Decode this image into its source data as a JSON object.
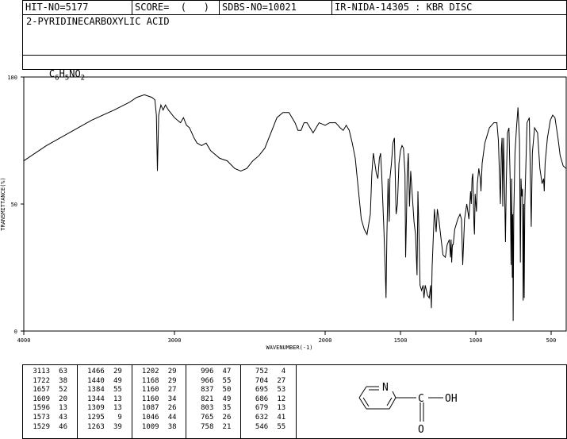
{
  "header": {
    "hit_no": "HIT-NO=5177",
    "score": "SCORE=  (   )",
    "sdbs_no": "SDBS-NO=10021",
    "ir_info": "IR-NIDA-14305 : KBR DISC"
  },
  "compound": {
    "name": "2-PYRIDINECARBOXYLIC ACID",
    "formula_parts": [
      "C",
      "6",
      "H",
      "5",
      "NO",
      "2"
    ]
  },
  "chart_data": {
    "type": "line",
    "xlabel": "WAVENUMBER(-1)",
    "ylabel": "TRANSMITTANCE(%)",
    "xlim": [
      4000,
      400
    ],
    "ylim": [
      0,
      100
    ],
    "x_reversed": true,
    "x_ticks": [
      4000,
      3000,
      2000,
      1500,
      1000,
      500
    ],
    "y_ticks": [
      0,
      50,
      100
    ],
    "x_tick_labels": [
      "4000",
      "3000",
      "2000",
      "1500",
      "1000",
      "500"
    ],
    "y_tick_labels": [
      "0",
      "50",
      "100"
    ],
    "series": [
      {
        "points": [
          [
            4000,
            67
          ],
          [
            3850,
            73
          ],
          [
            3700,
            78
          ],
          [
            3550,
            83
          ],
          [
            3400,
            87
          ],
          [
            3300,
            90
          ],
          [
            3250,
            92
          ],
          [
            3200,
            93
          ],
          [
            3150,
            92
          ],
          [
            3130,
            91
          ],
          [
            3120,
            85
          ],
          [
            3113,
            63
          ],
          [
            3105,
            85
          ],
          [
            3090,
            89
          ],
          [
            3075,
            87
          ],
          [
            3060,
            89
          ],
          [
            3040,
            87
          ],
          [
            3000,
            84
          ],
          [
            2960,
            82
          ],
          [
            2940,
            84
          ],
          [
            2920,
            81
          ],
          [
            2900,
            80
          ],
          [
            2870,
            76
          ],
          [
            2850,
            74
          ],
          [
            2820,
            73
          ],
          [
            2790,
            74
          ],
          [
            2760,
            71
          ],
          [
            2700,
            68
          ],
          [
            2650,
            67
          ],
          [
            2600,
            64
          ],
          [
            2560,
            63
          ],
          [
            2520,
            64
          ],
          [
            2480,
            67
          ],
          [
            2440,
            69
          ],
          [
            2400,
            72
          ],
          [
            2360,
            78
          ],
          [
            2320,
            84
          ],
          [
            2280,
            86
          ],
          [
            2240,
            86
          ],
          [
            2200,
            82
          ],
          [
            2180,
            79
          ],
          [
            2160,
            79
          ],
          [
            2140,
            82
          ],
          [
            2120,
            82
          ],
          [
            2100,
            80
          ],
          [
            2080,
            78
          ],
          [
            2060,
            80
          ],
          [
            2040,
            82
          ],
          [
            2000,
            81
          ],
          [
            1970,
            82
          ],
          [
            1930,
            82
          ],
          [
            1900,
            80
          ],
          [
            1880,
            79
          ],
          [
            1860,
            81
          ],
          [
            1840,
            79
          ],
          [
            1820,
            74
          ],
          [
            1800,
            68
          ],
          [
            1780,
            56
          ],
          [
            1760,
            44
          ],
          [
            1740,
            40
          ],
          [
            1722,
            38
          ],
          [
            1700,
            46
          ],
          [
            1690,
            62
          ],
          [
            1680,
            70
          ],
          [
            1670,
            66
          ],
          [
            1660,
            62
          ],
          [
            1650,
            60
          ],
          [
            1640,
            68
          ],
          [
            1632,
            70
          ],
          [
            1625,
            62
          ],
          [
            1610,
            40
          ],
          [
            1600,
            22
          ],
          [
            1596,
            13
          ],
          [
            1590,
            38
          ],
          [
            1582,
            60
          ],
          [
            1575,
            43
          ],
          [
            1570,
            60
          ],
          [
            1560,
            66
          ],
          [
            1550,
            74
          ],
          [
            1540,
            76
          ],
          [
            1529,
            46
          ],
          [
            1520,
            50
          ],
          [
            1510,
            66
          ],
          [
            1500,
            71
          ],
          [
            1490,
            73
          ],
          [
            1480,
            72
          ],
          [
            1470,
            62
          ],
          [
            1466,
            29
          ],
          [
            1460,
            45
          ],
          [
            1455,
            62
          ],
          [
            1448,
            70
          ],
          [
            1440,
            49
          ],
          [
            1432,
            63
          ],
          [
            1420,
            52
          ],
          [
            1410,
            43
          ],
          [
            1400,
            38
          ],
          [
            1390,
            22
          ],
          [
            1384,
            55
          ],
          [
            1378,
            40
          ],
          [
            1370,
            18
          ],
          [
            1360,
            16
          ],
          [
            1350,
            18
          ],
          [
            1344,
            13
          ],
          [
            1336,
            18
          ],
          [
            1320,
            14
          ],
          [
            1309,
            13
          ],
          [
            1300,
            18
          ],
          [
            1295,
            9
          ],
          [
            1290,
            25
          ],
          [
            1275,
            48
          ],
          [
            1263,
            39
          ],
          [
            1255,
            48
          ],
          [
            1245,
            44
          ],
          [
            1230,
            36
          ],
          [
            1218,
            30
          ],
          [
            1202,
            29
          ],
          [
            1190,
            34
          ],
          [
            1176,
            36
          ],
          [
            1168,
            29
          ],
          [
            1164,
            36
          ],
          [
            1160,
            27
          ],
          [
            1155,
            34
          ],
          [
            1150,
            34
          ],
          [
            1140,
            40
          ],
          [
            1120,
            44
          ],
          [
            1105,
            46
          ],
          [
            1095,
            44
          ],
          [
            1087,
            26
          ],
          [
            1075,
            44
          ],
          [
            1060,
            50
          ],
          [
            1050,
            46
          ],
          [
            1046,
            44
          ],
          [
            1035,
            55
          ],
          [
            1030,
            50
          ],
          [
            1025,
            60
          ],
          [
            1020,
            62
          ],
          [
            1012,
            42
          ],
          [
            1009,
            38
          ],
          [
            1004,
            54
          ],
          [
            996,
            47
          ],
          [
            990,
            58
          ],
          [
            980,
            64
          ],
          [
            970,
            60
          ],
          [
            966,
            55
          ],
          [
            958,
            66
          ],
          [
            940,
            74
          ],
          [
            910,
            80
          ],
          [
            880,
            82
          ],
          [
            860,
            82
          ],
          [
            850,
            75
          ],
          [
            837,
            50
          ],
          [
            830,
            72
          ],
          [
            826,
            76
          ],
          [
            821,
            49
          ],
          [
            816,
            76
          ],
          [
            810,
            60
          ],
          [
            803,
            35
          ],
          [
            798,
            58
          ],
          [
            790,
            78
          ],
          [
            780,
            80
          ],
          [
            772,
            60
          ],
          [
            766,
            26
          ],
          [
            762,
            60
          ],
          [
            758,
            21
          ],
          [
            755,
            46
          ],
          [
            752,
            4
          ],
          [
            748,
            46
          ],
          [
            740,
            70
          ],
          [
            730,
            80
          ],
          [
            720,
            88
          ],
          [
            710,
            75
          ],
          [
            704,
            27
          ],
          [
            700,
            60
          ],
          [
            695,
            53
          ],
          [
            690,
            56
          ],
          [
            686,
            12
          ],
          [
            682,
            50
          ],
          [
            679,
            13
          ],
          [
            675,
            50
          ],
          [
            660,
            82
          ],
          [
            645,
            84
          ],
          [
            632,
            41
          ],
          [
            625,
            70
          ],
          [
            610,
            80
          ],
          [
            590,
            78
          ],
          [
            575,
            64
          ],
          [
            560,
            58
          ],
          [
            550,
            60
          ],
          [
            546,
            55
          ],
          [
            540,
            66
          ],
          [
            525,
            76
          ],
          [
            505,
            83
          ],
          [
            490,
            85
          ],
          [
            475,
            84
          ],
          [
            455,
            76
          ],
          [
            440,
            69
          ],
          [
            420,
            65
          ],
          [
            400,
            64
          ]
        ]
      }
    ]
  },
  "peak_table": {
    "columns": [
      [
        [
          "3113",
          "63"
        ],
        [
          "1722",
          "38"
        ],
        [
          "1657",
          "52"
        ],
        [
          "1609",
          "20"
        ],
        [
          "1596",
          "13"
        ],
        [
          "1573",
          "43"
        ],
        [
          "1529",
          "46"
        ]
      ],
      [
        [
          "1466",
          "29"
        ],
        [
          "1440",
          "49"
        ],
        [
          "1384",
          "55"
        ],
        [
          "1344",
          "13"
        ],
        [
          "1309",
          "13"
        ],
        [
          "1295",
          "9"
        ],
        [
          "1263",
          "39"
        ]
      ],
      [
        [
          "1202",
          "29"
        ],
        [
          "1168",
          "29"
        ],
        [
          "1160",
          "27"
        ],
        [
          "1160",
          "34"
        ],
        [
          "1087",
          "26"
        ],
        [
          "1046",
          "44"
        ],
        [
          "1009",
          "38"
        ]
      ],
      [
        [
          "996",
          "47"
        ],
        [
          "966",
          "55"
        ],
        [
          "837",
          "50"
        ],
        [
          "821",
          "49"
        ],
        [
          "803",
          "35"
        ],
        [
          "765",
          "26"
        ],
        [
          "758",
          "21"
        ]
      ],
      [
        [
          "752",
          "4"
        ],
        [
          "704",
          "27"
        ],
        [
          "695",
          "53"
        ],
        [
          "686",
          "12"
        ],
        [
          "679",
          "13"
        ],
        [
          "632",
          "41"
        ],
        [
          "546",
          "55"
        ]
      ]
    ]
  },
  "structure": {
    "n_label": "N",
    "c_label": "C",
    "o_label": "O",
    "oh_label": "OH"
  }
}
